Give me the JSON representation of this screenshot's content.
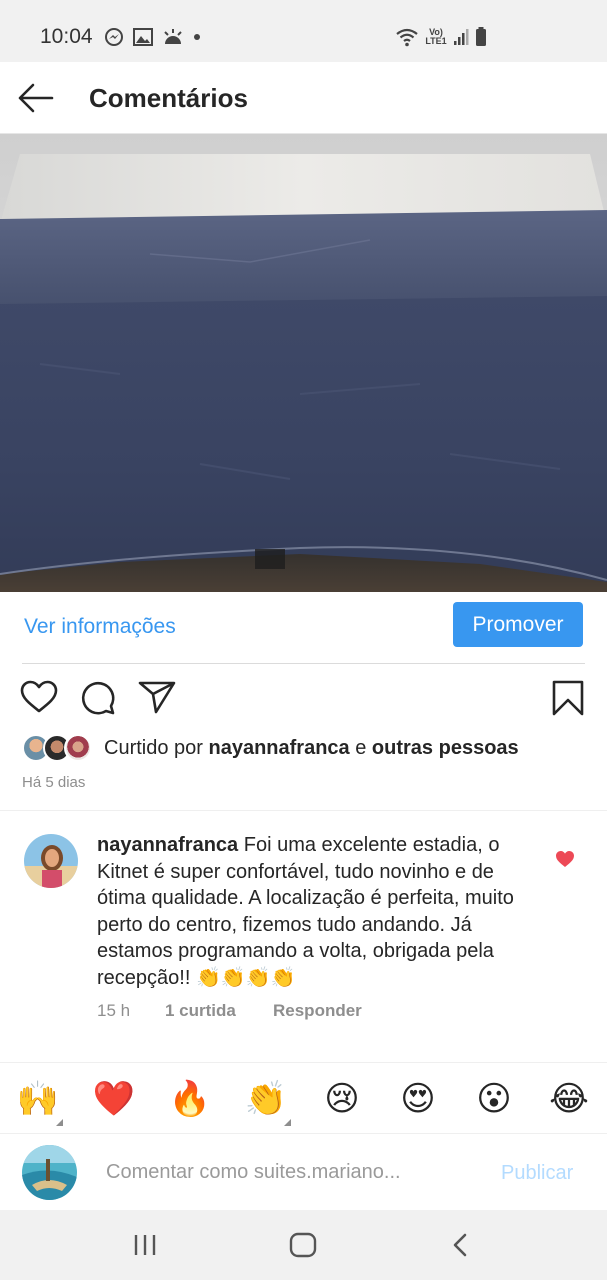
{
  "status_bar": {
    "time": "10:04",
    "network_label": "Vo) LTE1"
  },
  "header": {
    "title": "Comentários"
  },
  "promo": {
    "view_info_label": "Ver informações",
    "promote_label": "Promover",
    "accent_color": "#3897f0"
  },
  "post": {
    "liked_by_prefix": "Curtido por ",
    "liked_by_user": "nayannafranca",
    "liked_by_joiner": " e ",
    "liked_by_others": "outras pessoas",
    "date": "Há 5 dias"
  },
  "comment": {
    "username": "nayannafranca",
    "text": "Foi uma excelente estadia, o Kitnet é super confortável, tudo novinho e de ótima qualidade. A localização é perfeita, muito perto do centro, fizemos tudo andando. Já estamos programando a volta, obrigada pela recepção!! 👏👏👏👏",
    "time": "15 h",
    "likes": "1 curtida",
    "reply_label": "Responder",
    "liked": true,
    "heart_color": "#ed4956"
  },
  "emoji_bar": [
    "🙌",
    "❤️",
    "🔥",
    "👏",
    "😢",
    "😍",
    "😮",
    "😂"
  ],
  "comment_input": {
    "placeholder": "Comentar como suites.mariano...",
    "publish_label": "Publicar"
  }
}
